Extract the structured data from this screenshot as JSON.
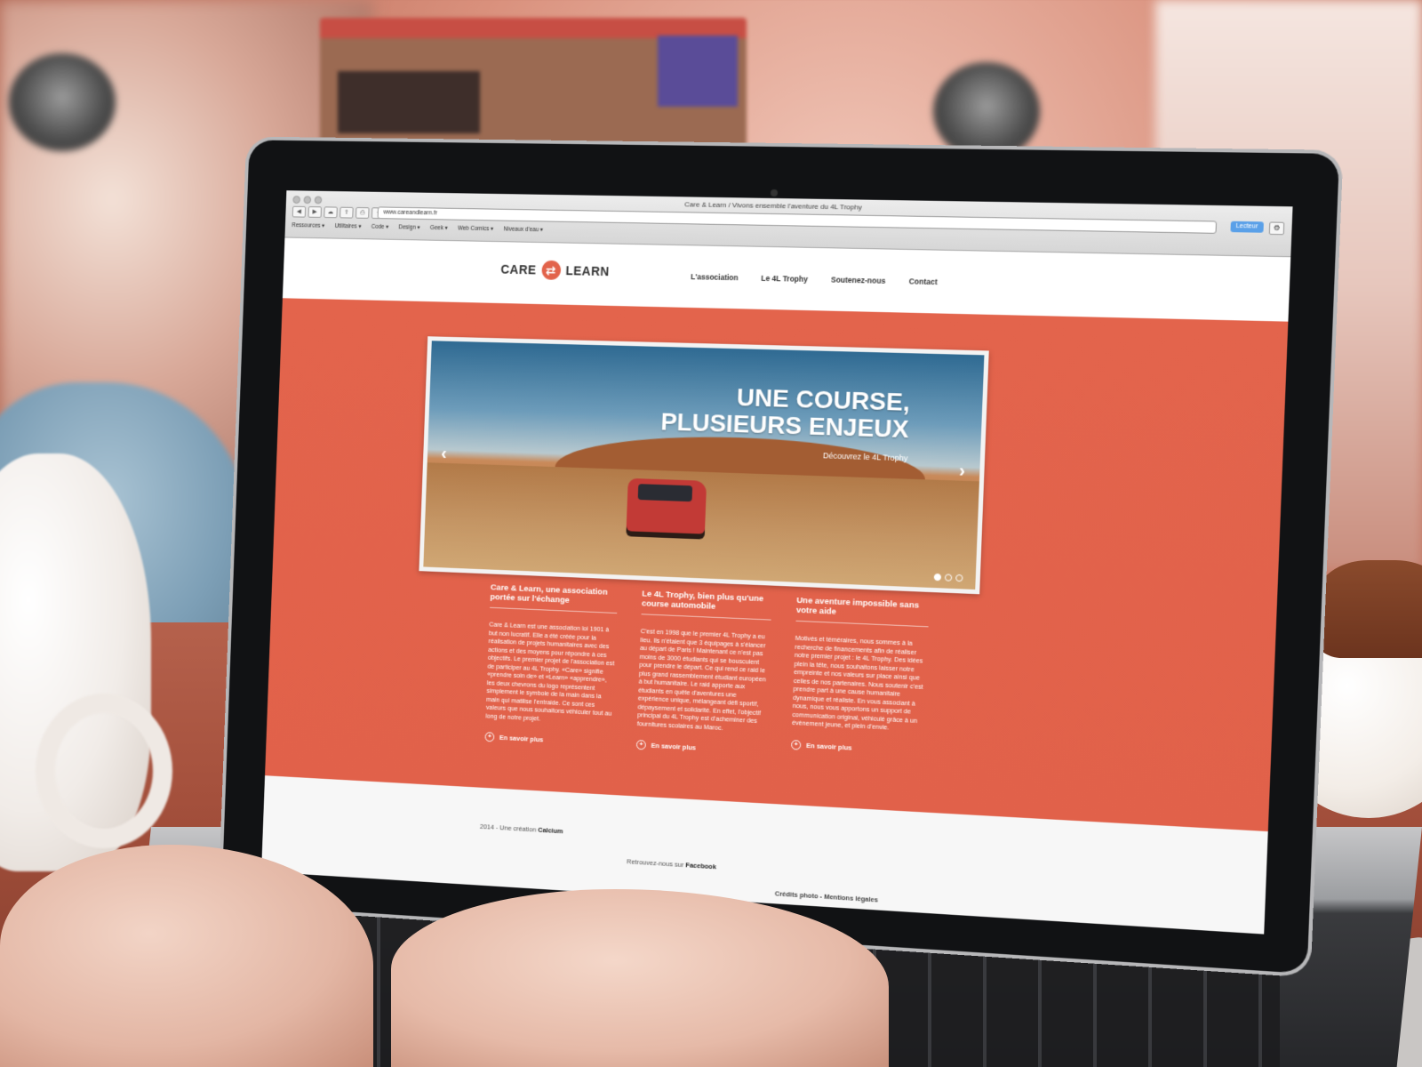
{
  "browser": {
    "window_title": "Care & Learn / Vivons ensemble l'aventure du 4L Trophy",
    "url": "www.careandlearn.fr",
    "reader_label": "Lecteur",
    "bookmarks": [
      "Ressources ▾",
      "Utilitaires ▾",
      "Code ▾",
      "Design ▾",
      "Geek ▾",
      "Web Comics ▾",
      "Niveaux d'eau ▾"
    ]
  },
  "site": {
    "logo_left": "CARE",
    "logo_right": "LEARN",
    "nav": [
      "L'association",
      "Le 4L Trophy",
      "Soutenez-nous",
      "Contact"
    ],
    "slide": {
      "title_line1": "UNE COURSE,",
      "title_line2": "PLUSIEURS ENJEUX",
      "subtitle": "Découvrez le 4L Trophy"
    },
    "columns": [
      {
        "title": "Care & Learn, une association portée sur l'échange",
        "body": "Care & Learn est une association loi 1901 à but non lucratif. Elle a été créée pour la réalisation de projets humanitaires avec des actions et des moyens pour répondre à ces objectifs. Le premier projet de l'association est de participer au 4L Trophy. «Care» signifie «prendre soin de» et «Learn» «apprendre», les deux chevrons du logo représentent simplement le symbole de la main dans la main qui matilise l'entraide. Ce sont ces valeurs que nous souhaitons véhiculer tout au long de notre projet.",
        "more": "En savoir plus"
      },
      {
        "title": "Le 4L Trophy, bien plus qu'une course automobile",
        "body": "C'est en 1998 que le premier 4L Trophy a eu lieu. Ils n'étaient que 3 équipages à s'élancer au départ de Paris ! Maintenant ce n'est pas moins de 3000 étudiants qui se bousculent pour prendre le départ. Ce qui rend ce raid le plus grand rassemblement étudiant européen à but humanitaire. Le raid apporte aux étudiants en quête d'aventures une expérience unique, mélangeant défi sportif, dépaysement et solidarité. En effet, l'objectif principal du 4L Trophy est d'acheminer des fournitures scolaires au Maroc.",
        "more": "En savoir plus"
      },
      {
        "title": "Une aventure impossible sans votre aide",
        "body": "Motivés et téméraires, nous sommes à la recherche de financements afin de réaliser notre premier projet : le 4L Trophy. Des idées plein la tête, nous souhaitons laisser notre empreinte et nos valeurs sur place ainsi que celles de nos partenaires. Nous soutenir c'est prendre part à une cause humanitaire dynamique et réaliste. En vous associant à nous, nous vous apportons un support de communication original, véhiculé grâce à un évènement jeune, et plein d'envie.",
        "more": "En savoir plus"
      }
    ],
    "footer": {
      "credit_prefix": "2014 - Une création",
      "credit_name": "Calcium",
      "social_prefix": "Retrouvez-nous sur",
      "social_name": "Facebook",
      "legal": "Crédits photo - Mentions légales"
    }
  },
  "colors": {
    "brand_orange": "#e3644c",
    "reader_blue": "#5aa0e8"
  }
}
